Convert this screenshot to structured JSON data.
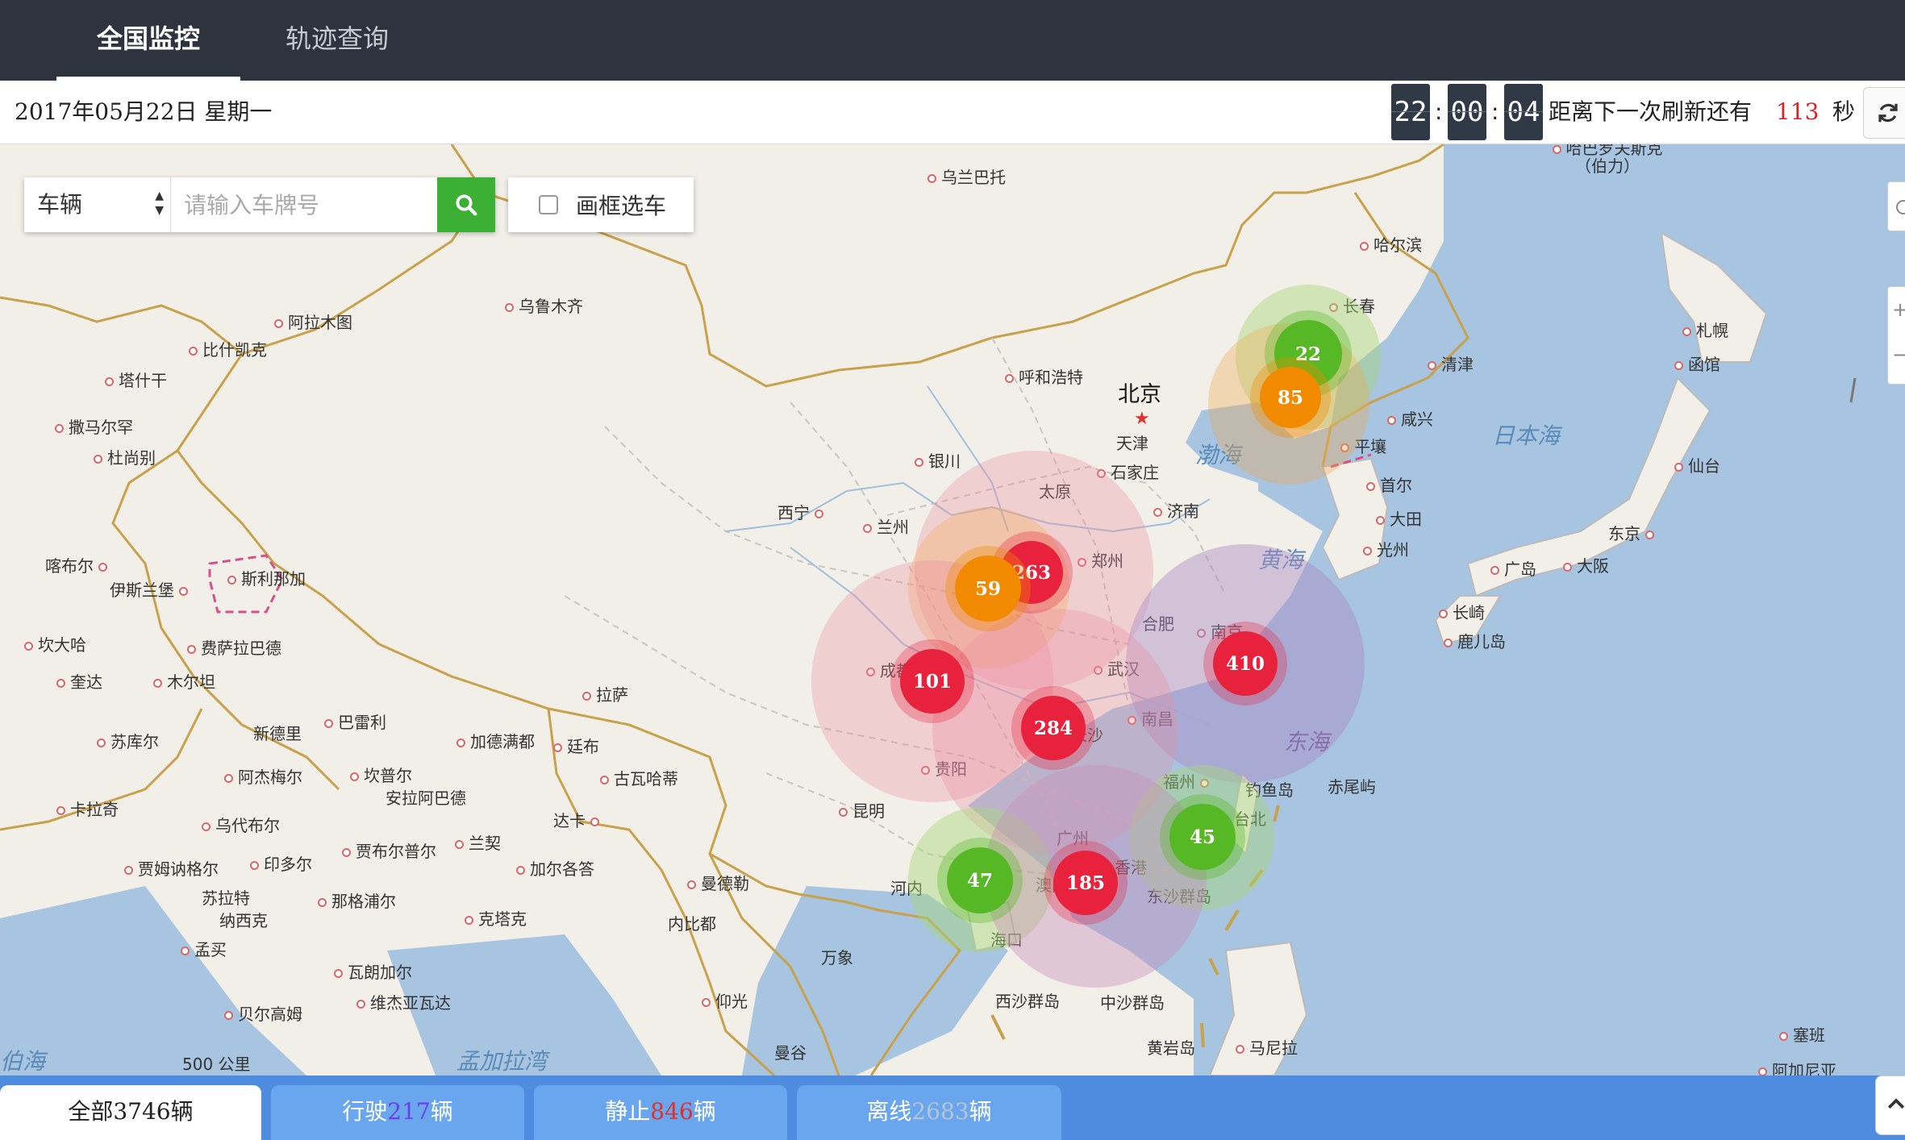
{
  "nav": {
    "tabs": [
      {
        "label": "全国监控",
        "active": true
      },
      {
        "label": "轨迹查询",
        "active": false
      }
    ]
  },
  "info": {
    "date": "2017年05月22日 星期一",
    "clock": {
      "hh": "22",
      "mm": "00",
      "ss": "04"
    },
    "refresh_prefix": "距离下一次刷新还有",
    "refresh_seconds": "113",
    "refresh_suffix": "秒"
  },
  "search": {
    "type_value": "车辆",
    "placeholder": "请输入车牌号",
    "frame_select_label": "画框选车"
  },
  "map": {
    "capital": "北京",
    "seas": [
      "渤海",
      "黄海",
      "东海",
      "日本海",
      "孟加拉湾",
      "伯海"
    ],
    "cities": [
      "乌兰巴托",
      "哈巴罗夫斯克（伯力）",
      "哈尔滨",
      "长春",
      "札幌",
      "函馆",
      "清津",
      "乌鲁木齐",
      "阿拉木图",
      "比什凯克",
      "塔什干",
      "撒马尔罕",
      "杜尚别",
      "呼和浩特",
      "天津",
      "石家庄",
      "咸兴",
      "平壤",
      "首尔",
      "大田",
      "光州",
      "仙台",
      "银川",
      "太原",
      "济南",
      "西宁",
      "兰州",
      "郑州",
      "东京",
      "广岛",
      "大阪",
      "长崎",
      "鹿儿岛",
      "喀布尔",
      "伊斯兰堡",
      "斯利那加",
      "坎大哈",
      "费萨拉巴德",
      "奎达",
      "木尔坦",
      "合肥",
      "南京",
      "成都",
      "武汉",
      "拉萨",
      "巴雷利",
      "新德里",
      "加德满都",
      "廷布",
      "苏库尔",
      "长沙",
      "南昌",
      "贵阳",
      "阿杰梅尔",
      "坎普尔",
      "古瓦哈蒂",
      "安拉阿巴德",
      "福州",
      "钓鱼岛",
      "赤尾屿",
      "卡拉奇",
      "乌代布尔",
      "达卡",
      "昆明",
      "台北",
      "广州",
      "兰契",
      "贾布尔普尔",
      "加尔各答",
      "贾姆讷格尔",
      "印多尔",
      "曼德勒",
      "河内",
      "澳门",
      "香港",
      "东沙群岛",
      "苏拉特",
      "那格浦尔",
      "纳西克",
      "克塔克",
      "内比都",
      "海口",
      "孟买",
      "万象",
      "瓦朗加尔",
      "西沙群岛",
      "中沙群岛",
      "维杰亚瓦达",
      "仰光",
      "贝尔高姆",
      "黄岩岛",
      "马尼拉",
      "曼谷",
      "塞班",
      "阿加尼亚"
    ],
    "scale": "500 公里",
    "clusters": [
      {
        "count": "22",
        "level": "green"
      },
      {
        "count": "85",
        "level": "orange"
      },
      {
        "count": "263",
        "level": "red"
      },
      {
        "count": "59",
        "level": "orange"
      },
      {
        "count": "101",
        "level": "red"
      },
      {
        "count": "410",
        "level": "red"
      },
      {
        "count": "284",
        "level": "red"
      },
      {
        "count": "45",
        "level": "green"
      },
      {
        "count": "47",
        "level": "green"
      },
      {
        "count": "185",
        "level": "red"
      }
    ]
  },
  "bottom": {
    "tabs": [
      {
        "prefix": "全部",
        "count": "3746",
        "suffix": "辆",
        "active": true
      },
      {
        "prefix": "行驶",
        "count": "217",
        "suffix": "辆",
        "active": false
      },
      {
        "prefix": "静止",
        "count": "846",
        "suffix": "辆",
        "active": false
      },
      {
        "prefix": "离线",
        "count": "2683",
        "suffix": "辆",
        "active": false
      }
    ]
  },
  "colors": {
    "nav_bg": "#2e343d",
    "search_btn": "#3cb034",
    "bottom_bar": "#4d8cde",
    "refresh_number": "#e02020",
    "moving": "#6b3ee8",
    "stopped": "#e03030",
    "offline": "#b7c4d4",
    "cluster_red": "#e8223c",
    "cluster_orange": "#f28a00",
    "cluster_green": "#55b824"
  },
  "icons": [
    "search-icon",
    "refresh-icon",
    "checkbox-icon",
    "location-icon",
    "collapse-icon"
  ]
}
